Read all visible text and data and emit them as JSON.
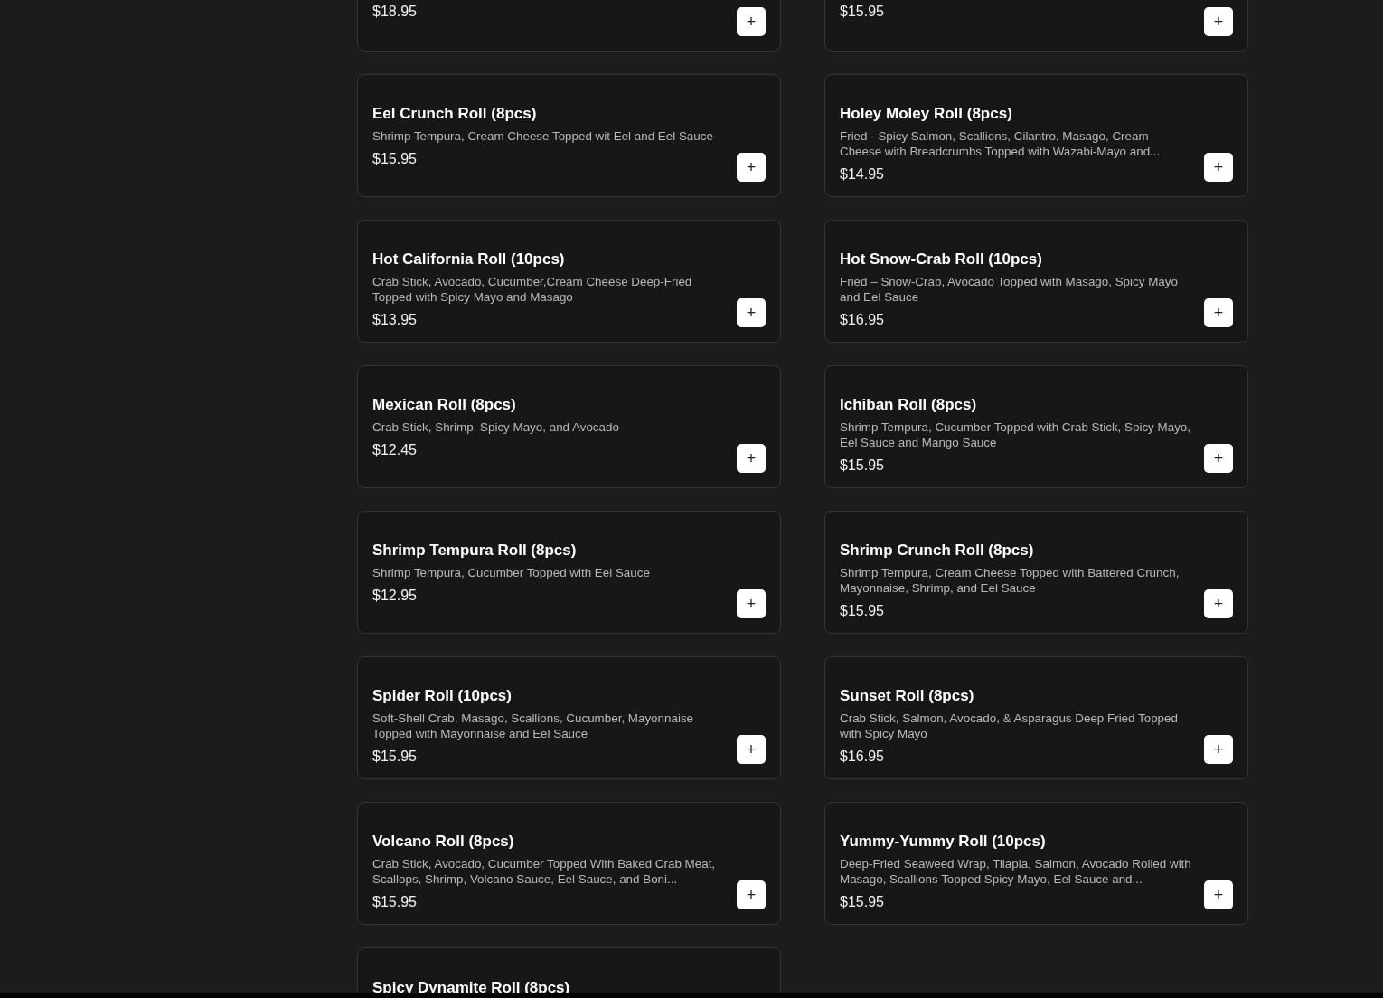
{
  "menu_items": [
    {
      "price": "$18.95",
      "add_label": "+"
    },
    {
      "price": "$15.95",
      "add_label": "+"
    },
    {
      "name": "Eel Crunch Roll (8pcs)",
      "description": "Shrimp Tempura, Cream Cheese Topped wit Eel and Eel Sauce",
      "price": "$15.95",
      "add_label": "+"
    },
    {
      "name": "Holey Moley Roll (8pcs)",
      "description": "Fried - Spicy Salmon, Scallions, Cilantro, Masago, Cream Cheese with Breadcrumbs Topped with Wazabi-Mayo and...",
      "price": "$14.95",
      "add_label": "+"
    },
    {
      "name": "Hot California Roll (10pcs)",
      "description": "Crab Stick, Avocado, Cucumber,Cream Cheese Deep-Fried Topped with Spicy Mayo and Masago",
      "price": "$13.95",
      "add_label": "+"
    },
    {
      "name": "Hot Snow-Crab Roll (10pcs)",
      "description": "Fried – Snow-Crab, Avocado Topped with Masago, Spicy Mayo and Eel Sauce",
      "price": "$16.95",
      "add_label": "+"
    },
    {
      "name": "Mexican Roll (8pcs)",
      "description": "Crab Stick, Shrimp, Spicy Mayo, and Avocado",
      "price": "$12.45",
      "add_label": "+"
    },
    {
      "name": "Ichiban Roll (8pcs)",
      "description": "Shrimp Tempura, Cucumber Topped with Crab Stick, Spicy Mayo, Eel Sauce and Mango Sauce",
      "price": "$15.95",
      "add_label": "+"
    },
    {
      "name": "Shrimp Tempura Roll (8pcs)",
      "description": "Shrimp Tempura, Cucumber Topped with Eel Sauce",
      "price": "$12.95",
      "add_label": "+"
    },
    {
      "name": "Shrimp Crunch Roll (8pcs)",
      "description": "Shrimp Tempura, Cream Cheese Topped with Battered Crunch, Mayonnaise, Shrimp, and Eel Sauce",
      "price": "$15.95",
      "add_label": "+"
    },
    {
      "name": "Spider Roll (10pcs)",
      "description": "Soft-Shell Crab, Masago, Scallions, Cucumber, Mayonnaise Topped with Mayonnaise and Eel Sauce",
      "price": "$15.95",
      "add_label": "+"
    },
    {
      "name": "Sunset Roll (8pcs)",
      "description": "Crab Stick, Salmon, Avocado, & Asparagus Deep Fried Topped with Spicy Mayo",
      "price": "$16.95",
      "add_label": "+"
    },
    {
      "name": "Volcano Roll (8pcs)",
      "description": "Crab Stick, Avocado, Cucumber Topped With Baked Crab Meat, Scallops, Shrimp, Volcano Sauce, Eel Sauce, and Boni...",
      "price": "$15.95",
      "add_label": "+"
    },
    {
      "name": "Yummy-Yummy Roll (10pcs)",
      "description": "Deep-Fried Seaweed Wrap, Tilapia, Salmon, Avocado Rolled with Masago, Scallions Topped Spicy Mayo, Eel Sauce and...",
      "price": "$15.95",
      "add_label": "+"
    },
    {
      "name": "Spicy Dynamite Roll (8pcs)"
    }
  ]
}
